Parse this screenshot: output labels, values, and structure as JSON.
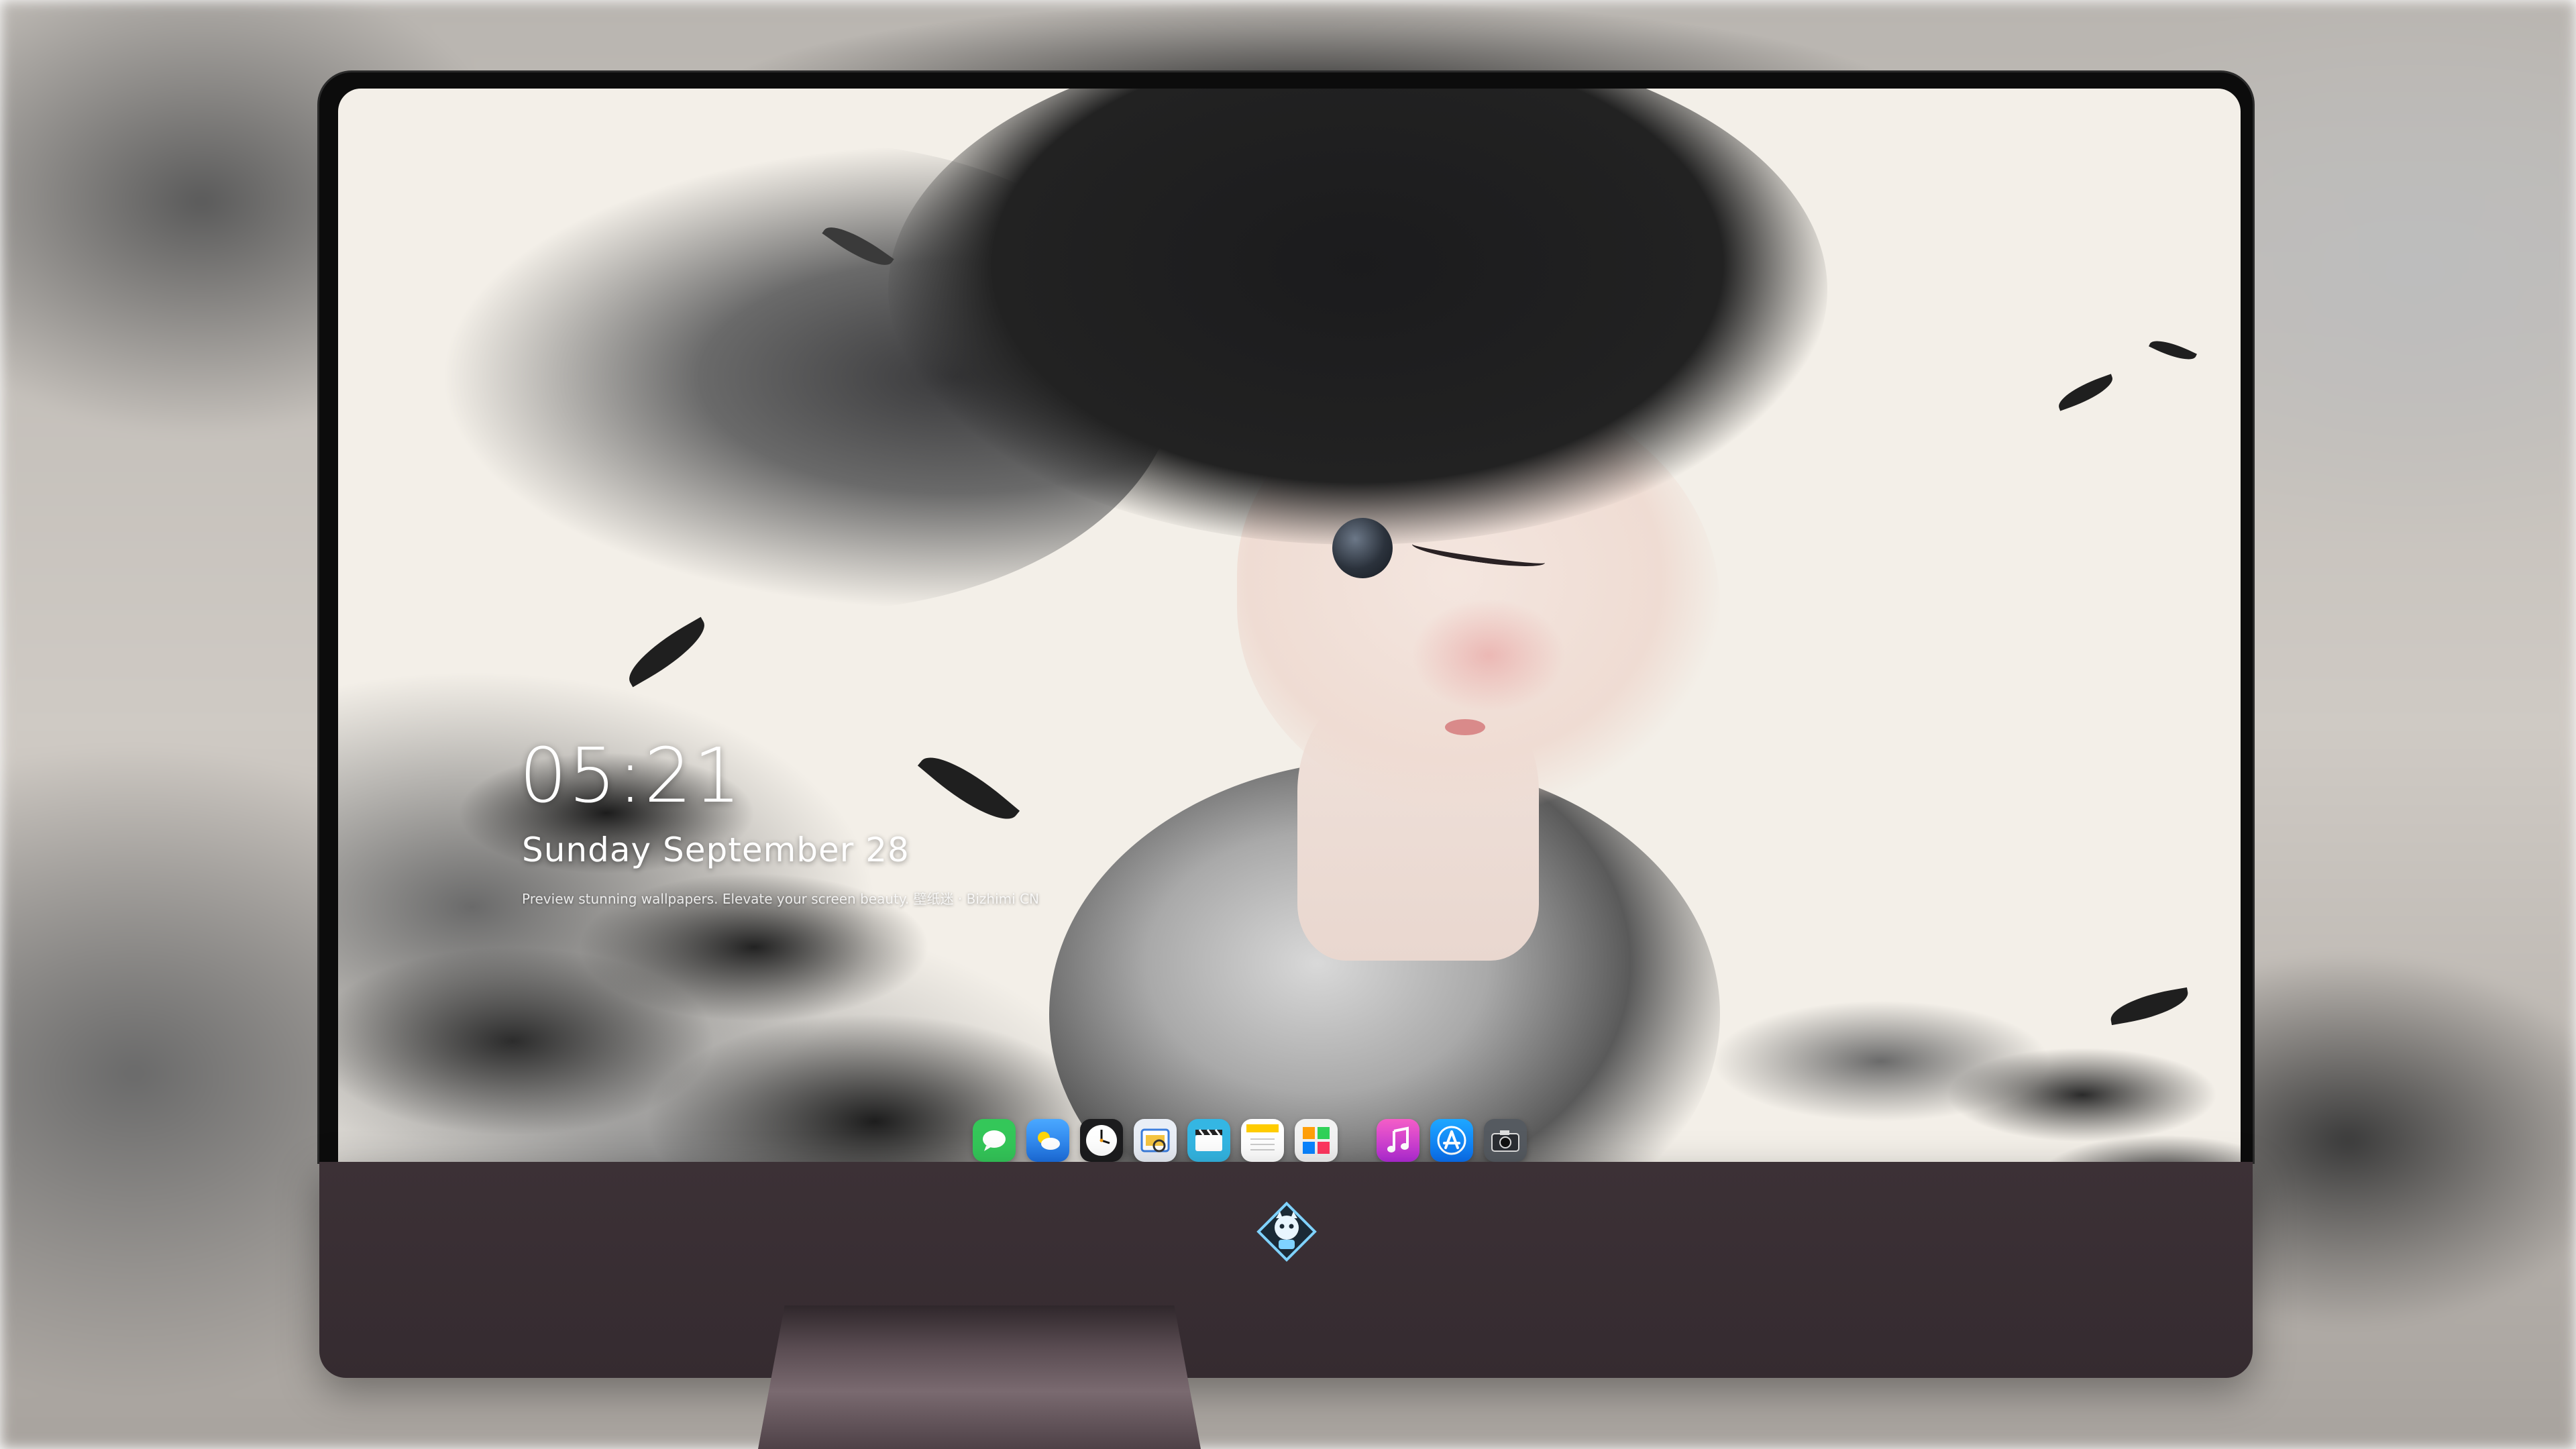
{
  "lockscreen": {
    "time": "05:21",
    "date": "Sunday September  28",
    "tagline": "Preview stunning wallpapers. Elevate your screen beauty. 壁纸迷 · Bizhimi CN"
  },
  "dock": {
    "apps": [
      {
        "name": "messages-icon",
        "color": "#34c759"
      },
      {
        "name": "weather-icon",
        "color": "#2f8cf2"
      },
      {
        "name": "clock-icon",
        "color": "#1c1c1e"
      },
      {
        "name": "preview-icon",
        "color": "#e9eef6"
      },
      {
        "name": "clips-icon",
        "color": "#34b6e3"
      },
      {
        "name": "notes-icon",
        "color": "#ffffff"
      },
      {
        "name": "photos-icon",
        "color": "#f2f2f2"
      },
      {
        "name": "music-icon",
        "color": "#d23ec4"
      },
      {
        "name": "app-store-icon",
        "color": "#1e90ff"
      },
      {
        "name": "camera-icon",
        "color": "#555a60"
      }
    ]
  },
  "colors": {
    "chin": "#3c3136",
    "screen_bg": "#f3efe8"
  }
}
